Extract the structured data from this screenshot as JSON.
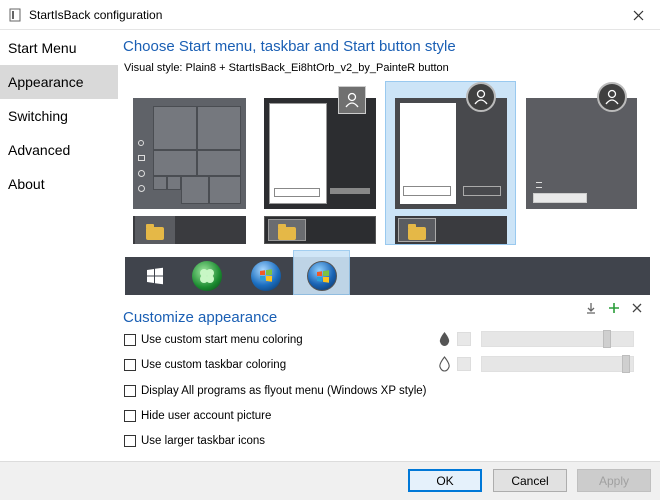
{
  "window": {
    "title": "StartIsBack configuration",
    "close_icon": "close-icon"
  },
  "sidebar": {
    "items": [
      {
        "label": "Start Menu",
        "selected": false
      },
      {
        "label": "Appearance",
        "selected": true
      },
      {
        "label": "Switching",
        "selected": false
      },
      {
        "label": "Advanced",
        "selected": false
      },
      {
        "label": "About",
        "selected": false
      }
    ]
  },
  "main": {
    "heading": "Choose Start menu, taskbar and Start button style",
    "visual_style": "Visual style:  Plain8 + StartIsBack_Ei8htOrb_v2_by_PainteR button",
    "start_styles": [
      "windows-10-tiles",
      "windows-7-classic",
      "windows-7-plain",
      "windows-10-minimal"
    ],
    "selected_style_index": 2,
    "orbs": [
      "windows-10-logo",
      "clover-orb",
      "windows-7-orb",
      "windows-8-orb"
    ],
    "selected_orb_index": 3
  },
  "customize": {
    "heading": "Customize appearance",
    "icons": [
      "download-icon",
      "plus-icon",
      "close-icon"
    ],
    "options": [
      {
        "label": "Use custom start menu coloring",
        "checked": false
      },
      {
        "label": "Use custom taskbar coloring",
        "checked": false
      },
      {
        "label": "Display All programs as flyout menu (Windows XP style)",
        "checked": false
      },
      {
        "label": "Hide user account picture",
        "checked": false
      },
      {
        "label": "Use larger taskbar icons",
        "checked": false
      }
    ],
    "sliders": [
      {
        "icon": "filled-drop-icon",
        "level": 0.85
      },
      {
        "icon": "outline-drop-icon",
        "level": 0.98
      }
    ]
  },
  "footer": {
    "ok": "OK",
    "cancel": "Cancel",
    "apply": "Apply"
  },
  "colors": {
    "accent": "#1a5fb4",
    "selection": "#cce4f7",
    "taskbar": "#40444c",
    "tile_gray": "#5f6268"
  }
}
